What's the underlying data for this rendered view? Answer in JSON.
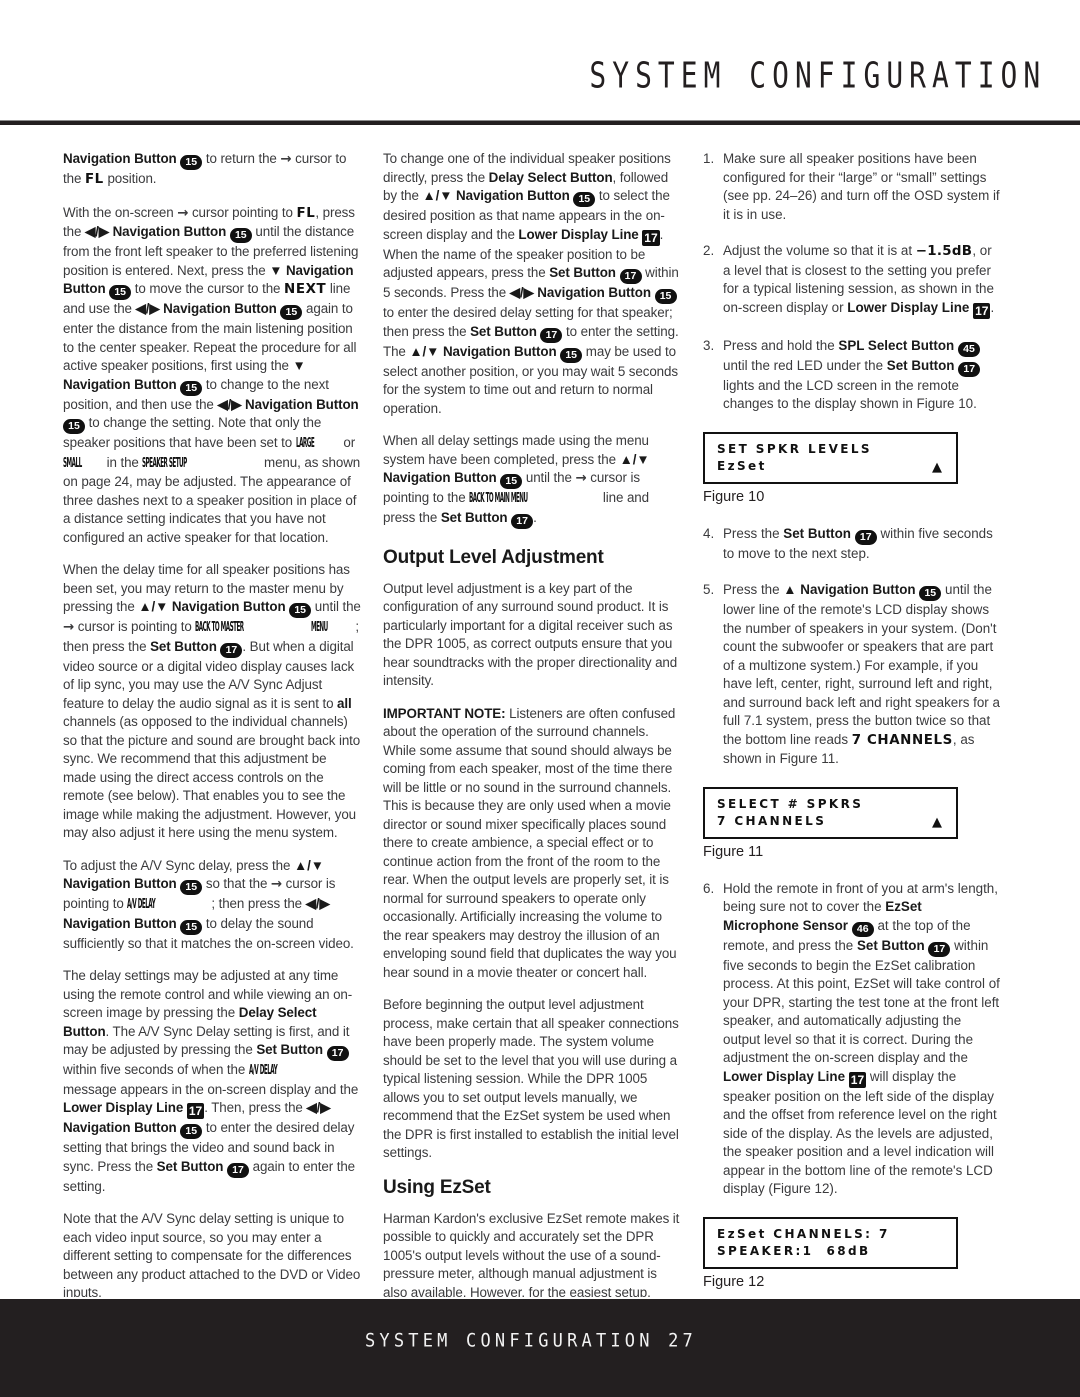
{
  "header": {
    "title": "SYSTEM CONFIGURATION"
  },
  "footer": {
    "text": "SYSTEM CONFIGURATION   27",
    "section": "SYSTEM CONFIGURATION",
    "page_number": "27"
  },
  "column1": {
    "p1_a": "Navigation Button",
    "p1_ref1": "15",
    "p1_b": " to return the ",
    "p1_arrow": "→",
    "p1_c": " cursor to the ",
    "p1_osd1": "FL",
    "p1_d": " position.",
    "p2_a": "With the on-screen ",
    "p2_arrow1": "→",
    "p2_b": " cursor pointing to ",
    "p2_osd1": "FL",
    "p2_c": ", press the ",
    "p2_nav1": "◀/▶ Navigation Button",
    "p2_ref1": "15",
    "p2_d": " until the distance from the front left speaker to the preferred listening position is entered. Next, press the ",
    "p2_nav2": "▼ Navigation Button",
    "p2_ref2": "15",
    "p2_e": " to move the cursor to the ",
    "p2_osd2": "NEXT",
    "p2_f": " line and use the ",
    "p2_nav3": "◀/▶ Navigation Button",
    "p2_ref3": "15",
    "p2_g": " again to enter the distance from the main listening position to the center speaker. Repeat the procedure for all active speaker positions, first using the ",
    "p2_nav4": "▼ Navigation Button",
    "p2_ref4": "15",
    "p2_h": " to change to the next position, and then use the ",
    "p2_nav5": "◀/▶ Navigation Button",
    "p2_ref5": "15",
    "p2_i": " to change the setting. Note that only the speaker positions that have been set to ",
    "p2_osd3": "LARGE",
    "p2_j": " or ",
    "p2_osd4": "SMALL",
    "p2_k": " in the ",
    "p2_osd5": "SPEAKER SETUP",
    "p2_l": " menu, as shown on page 24, may be adjusted. The appearance of three dashes next to a speaker position in place of a distance setting indicates that you have not configured an active speaker for that location.",
    "p3_a": "When the delay time for all speaker positions has been set, you may return to the master menu by pressing the ",
    "p3_nav1": "▲/▼ Navigation Button",
    "p3_ref1": "15",
    "p3_b": " until the ",
    "p3_arrow": "→",
    "p3_c": " cursor is pointing to ",
    "p3_osd1": "BACK TO MASTER",
    "p3_osd2": "MENU",
    "p3_d": "; then press the ",
    "p3_set": "Set Button",
    "p3_ref2": "17",
    "p3_e": ". But when a digital video source or a digital video display causes lack of lip sync, you may use the A/V Sync Adjust feature to delay the audio signal as it is sent to ",
    "p3_bold1": "all",
    "p3_f": " channels (as opposed to the individual channels) so that the picture and sound are brought back into sync. We recommend that this adjustment be made using the direct access controls on the remote (see below). That enables you to see the image while making the adjustment. However, you may also adjust it here using the menu system.",
    "p4_a": "To adjust the A/V Sync delay, press the ",
    "p4_nav1": "▲/▼ Navigation Button",
    "p4_ref1": "15",
    "p4_b": " so that the ",
    "p4_arrow": "→",
    "p4_c": " cursor is pointing to ",
    "p4_osd1": "A/V DELAY",
    "p4_d": "; then press the ",
    "p4_nav2": "◀/▶ Navigation Button",
    "p4_ref2": "15",
    "p4_e": " to delay the sound sufficiently so that it matches the on-screen video.",
    "p5_a": "The delay settings may be adjusted at any time using the remote control and while viewing an on-screen image by pressing the ",
    "p5_bold1": "Delay Select Button",
    "p5_b": ". The A/V Sync Delay setting is first, and it may be adjusted by pressing the ",
    "p5_bold2": "Set Button",
    "p5_ref1": "17",
    "p5_c": " within five seconds of when the ",
    "p5_osd1": "A/V DELAY",
    "p5_d": " message appears in the on-screen display and the ",
    "p5_bold3": "Lower Display Line",
    "p5_ref2": "17",
    "p5_e": ". Then, press the ",
    "p5_nav1": "◀/▶ Navigation Button",
    "p5_ref3": "15",
    "p5_f": " to enter the desired delay setting that brings the video and sound back in sync. Press the ",
    "p5_bold4": "Set Button",
    "p5_ref4": "17",
    "p5_g": " again to enter the setting.",
    "p6": "Note that the A/V Sync delay setting is unique to each video input source, so you may enter a different setting to compensate for the differences between any product attached to the DVD or Video inputs."
  },
  "column2": {
    "p1_a": "To change one of the individual speaker positions directly, press the ",
    "p1_bold1": "Delay Select Button",
    "p1_b": ", followed by the ",
    "p1_nav1": "▲/▼ Navigation Button",
    "p1_ref1": "15",
    "p1_c": " to select the desired position as that name appears in the on-screen display and the ",
    "p1_bold2": "Lower Display Line",
    "p1_ref2": "17",
    "p1_d": ". When the name of the speaker position to be adjusted appears, press the ",
    "p1_bold3": "Set Button",
    "p1_ref3": "17",
    "p1_e": " within 5 seconds. Press the ",
    "p1_nav2": "◀/▶ Navigation Button",
    "p1_ref4": "15",
    "p1_f": " to enter the desired delay setting for that speaker; then press the ",
    "p1_bold4": "Set Button",
    "p1_ref5": "17",
    "p1_g": " to enter the setting. The ",
    "p1_nav3": "▲/▼ Navigation Button",
    "p1_ref6": "15",
    "p1_h": " may be used to select another position, or you may wait 5 seconds for the system to time out and return to normal operation.",
    "p2_a": "When all delay settings made using the menu system have been completed, press the ",
    "p2_nav1": "▲/▼ Navigation Button",
    "p2_ref1": "15",
    "p2_b": " until the ",
    "p2_arrow": "→",
    "p2_c": " cursor is pointing to the ",
    "p2_osd1": "BACK TO MAIN MENU",
    "p2_d": " line and press the ",
    "p2_bold1": "Set Button",
    "p2_ref2": "17",
    "p2_e": ".",
    "heading1": "Output Level Adjustment",
    "p3": "Output level adjustment is a key part of the configuration of any surround sound product. It is particularly important for a digital receiver such as the DPR 1005, as correct outputs ensure that you hear soundtracks with the proper directionality and intensity.",
    "p4_bold": "IMPORTANT NOTE:",
    "p4_text": " Listeners are often confused about the operation of the surround channels. While some assume that sound should always be coming from each speaker, most of the time there will be little or no sound in the surround channels. This is because they are only used when a movie director or sound mixer specifically places sound there to create ambience, a special effect or to continue action from the front of the room to the rear. When the output levels are properly set, it is normal for surround speakers to operate only occasionally. Artificially increasing the volume to the rear speakers may destroy the illusion of an enveloping sound field that duplicates the way you hear sound in a movie theater or concert hall.",
    "p5": "Before beginning the output level adjustment process, make certain that all speaker connections have been properly made. The system volume should be set to the level that you will use during a typical listening session. While the DPR 1005 allows you to set output levels manually, we recommend that the EzSet system be used when the DPR is first installed to establish the initial level settings.",
    "heading2": "Using EzSet",
    "p6": "Harman Kardon's exclusive EzSet remote makes it possible to quickly and accurately set the DPR 1005's output levels without the use of a sound-pressure meter, although manual adjustment is also available. However, for the easiest setup, follow these steps while seated in the listening position that will be used most often:"
  },
  "column3": {
    "item1_num": "1.",
    "item1_text": "Make sure all speaker positions have been configured for their “large” or “small” settings (see pp. 24–26) and turn off the OSD system if it is in use.",
    "item2_num": "2.",
    "item2_a": "Adjust the volume so that it is at ",
    "item2_osd": "−1.5dB",
    "item2_b": ", or a level that is closest to the setting you prefer for a typical listening session, as shown in the on-screen display or ",
    "item2_bold": "Lower Display Line",
    "item2_ref": "17",
    "item2_c": ".",
    "item3_num": "3.",
    "item3_a": "Press and hold the ",
    "item3_bold1": "SPL Select Button",
    "item3_ref1": "45",
    "item3_b": " until the red LED under the ",
    "item3_bold2": "Set Button",
    "item3_ref2": "17",
    "item3_c": " lights and the LCD screen in the remote changes to the display shown in Figure 10.",
    "figure10_line1": "SET SPKR LEVELS",
    "figure10_line2": "EzSet",
    "figure10_arrow": "▲",
    "figure10_caption": "Figure 10",
    "item4_num": "4.",
    "item4_a": "Press the ",
    "item4_bold": "Set Button",
    "item4_ref": "17",
    "item4_b": " within five seconds to move to the next step.",
    "item5_num": "5.",
    "item5_a": "Press the ",
    "item5_nav": "▲ Navigation Button",
    "item5_ref": "15",
    "item5_b": " until the lower line of the remote's LCD display shows the number of speakers in your system. (Don't count the subwoofer or speakers that are part of a multizone system.) For example, if you have left, center, right, surround left and right, and surround back left and right speakers for a full 7.1 system, press the button twice so that the bottom line reads ",
    "item5_osd": "7 CHANNELS",
    "item5_c": ", as shown in Figure 11.",
    "figure11_line1": "SELECT # SPKRS",
    "figure11_line2": "7 CHANNELS",
    "figure11_arrow": "▲",
    "figure11_caption": "Figure 11",
    "item6_num": "6.",
    "item6_a": "Hold the remote in front of you at arm's length, being sure not to cover the ",
    "item6_bold1": "EzSet Microphone Sensor",
    "item6_ref1": "46",
    "item6_b": " at the top of the remote, and press the ",
    "item6_bold2": "Set Button",
    "item6_ref2": "17",
    "item6_c": " within five seconds to begin the EzSet calibration process. At this point, EzSet will take control of your DPR, starting the test tone at the front left speaker, and automatically adjusting the output level so that it is correct. During the adjustment the on-screen display and the ",
    "item6_bold3": "Lower Display Line",
    "item6_ref3": "17",
    "item6_d": " will display the speaker position on the left side of the display and the offset from reference level on the right side of the display. As the levels are adjusted, the speaker position and a level indication will appear in the bottom line of the remote's LCD display (Figure 12).",
    "figure12_line1": "EzSet CHANNELS: 7",
    "figure12_line2": "SPEAKER:1  68dB",
    "figure12_caption": "Figure 12"
  }
}
